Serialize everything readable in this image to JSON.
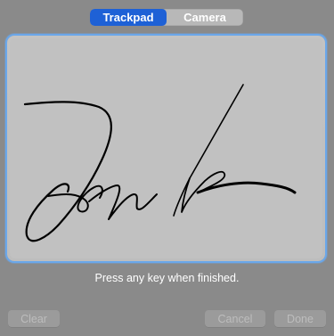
{
  "segmented_control": {
    "options": [
      {
        "label": "Trackpad",
        "selected": true
      },
      {
        "label": "Camera",
        "selected": false
      }
    ],
    "accent_color": "#1e61d6"
  },
  "signature_area": {
    "focus_ring_color": "#6aa7ea"
  },
  "instruction_text": "Press any key when finished.",
  "buttons": {
    "clear_label": "Clear",
    "cancel_label": "Cancel",
    "done_label": "Done"
  }
}
